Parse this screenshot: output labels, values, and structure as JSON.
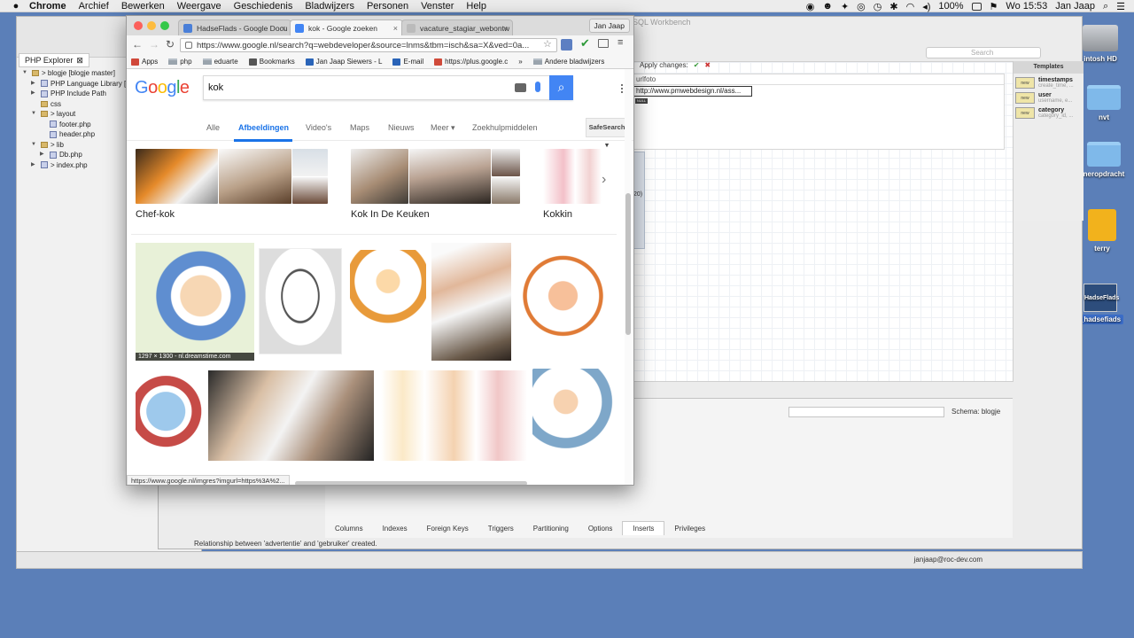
{
  "menubar": {
    "apple": "",
    "items": [
      "Chrome",
      "Archief",
      "Bewerken",
      "Weergave",
      "Geschiedenis",
      "Bladwijzers",
      "Personen",
      "Venster",
      "Help"
    ],
    "battery": "100%",
    "clock": "Wo 15:53",
    "user": "Jan Jaap"
  },
  "eclipse": {
    "tab_label": "PHP Explorer",
    "tree": [
      {
        "label": "> blogje [blogje master]",
        "indent": 0,
        "kind": "proj",
        "tri": "▼"
      },
      {
        "label": "PHP Language Library [",
        "indent": 1,
        "kind": "lib",
        "tri": "▶"
      },
      {
        "label": "PHP Include Path",
        "indent": 1,
        "kind": "lib",
        "tri": "▶"
      },
      {
        "label": "css",
        "indent": 1,
        "kind": "folder",
        "tri": ""
      },
      {
        "label": "> layout",
        "indent": 1,
        "kind": "folder",
        "tri": "▼"
      },
      {
        "label": "footer.php",
        "indent": 2,
        "kind": "php",
        "tri": ""
      },
      {
        "label": "header.php",
        "indent": 2,
        "kind": "php",
        "tri": ""
      },
      {
        "label": "> lib",
        "indent": 1,
        "kind": "folder",
        "tri": "▼"
      },
      {
        "label": "Db.php",
        "indent": 2,
        "kind": "php",
        "tri": "▶"
      },
      {
        "label": "> index.php",
        "indent": 1,
        "kind": "php",
        "tri": "▶"
      }
    ]
  },
  "workbench": {
    "title": "SQL Workbench",
    "search_placeholder": "Search",
    "templates_header": "Templates",
    "templates": [
      {
        "name": "timestamps",
        "desc": "create_time, ..."
      },
      {
        "name": "user",
        "desc": "username, e..."
      },
      {
        "name": "category",
        "desc": "category_id, ..."
      }
    ],
    "schema_label": "Schema:",
    "schema_value": "blogje",
    "apply_label": "Apply changes:",
    "grid_header": "urlfoto",
    "grid_cell": "http://www.pmwebdesign.nl/ass...",
    "null_badge": "NULL",
    "tabs": [
      "Columns",
      "Indexes",
      "Foreign Keys",
      "Triggers",
      "Partitioning",
      "Options",
      "Inserts",
      "Privileges"
    ],
    "active_tab": "Inserts",
    "status": "Relationship between 'advertentie' and 'gebruiker' created.",
    "side_fragment": "20)"
  },
  "taskbar": {
    "user": "janjaap@roc-dev.com"
  },
  "desktop": {
    "icons": [
      {
        "label": "intosh HD",
        "type": "hdd"
      },
      {
        "label": "nvt",
        "type": "folder"
      },
      {
        "label": "neropdracht",
        "type": "folder"
      },
      {
        "label": "terry",
        "type": "usb"
      },
      {
        "label": "_hadsefiads",
        "type": "thumb",
        "thumb_text": "HadseFlads"
      }
    ]
  },
  "chrome": {
    "tabs": [
      {
        "title": "HadseFlads - Google Docu",
        "fav_color": "#4a7fd8"
      },
      {
        "title": "kok - Google zoeken",
        "fav_color": "#4285f4"
      },
      {
        "title": "vacature_stagiar_webontw",
        "fav_color": "#bbbbbb"
      }
    ],
    "active_tab": 1,
    "profile": "Jan Jaap",
    "url": "https://www.google.nl/search?q=webdeveloper&source=lnms&tbm=isch&sa=X&ved=0a...",
    "bookmarks": [
      {
        "label": "Apps",
        "type": "apps"
      },
      {
        "label": "php",
        "type": "folder"
      },
      {
        "label": "eduarte",
        "type": "folder"
      },
      {
        "label": "Bookmarks",
        "type": "star"
      },
      {
        "label": "Jan Jaap Siewers - L",
        "type": "outlook"
      },
      {
        "label": "E-mail",
        "type": "mail"
      },
      {
        "label": "https://plus.google.c",
        "type": "gplus"
      },
      {
        "label": "»",
        "type": "more"
      },
      {
        "label": "Andere bladwijzers",
        "type": "folder"
      }
    ],
    "status_url": "https://www.google.nl/imgres?imgurl=https%3A%2..."
  },
  "google": {
    "logo": [
      "G",
      "o",
      "o",
      "g",
      "l",
      "e"
    ],
    "logo_colors": [
      "#4285f4",
      "#ea4335",
      "#fbbc05",
      "#4285f4",
      "#34a853",
      "#ea4335"
    ],
    "query": "kok",
    "search_icon": "search-icon",
    "tabs": [
      "Alle",
      "Afbeeldingen",
      "Video's",
      "Maps",
      "Nieuws",
      "Meer ▾",
      "Zoekhulpmiddelen"
    ],
    "active_tab": "Afbeeldingen",
    "safesearch": "SafeSearch ▾",
    "related": [
      {
        "label": "Chef-kok"
      },
      {
        "label": "Kok In De Keuken"
      },
      {
        "label": "Kokkin"
      }
    ],
    "result_caption": "1297 × 1300 - nl.dreamstime.com"
  }
}
